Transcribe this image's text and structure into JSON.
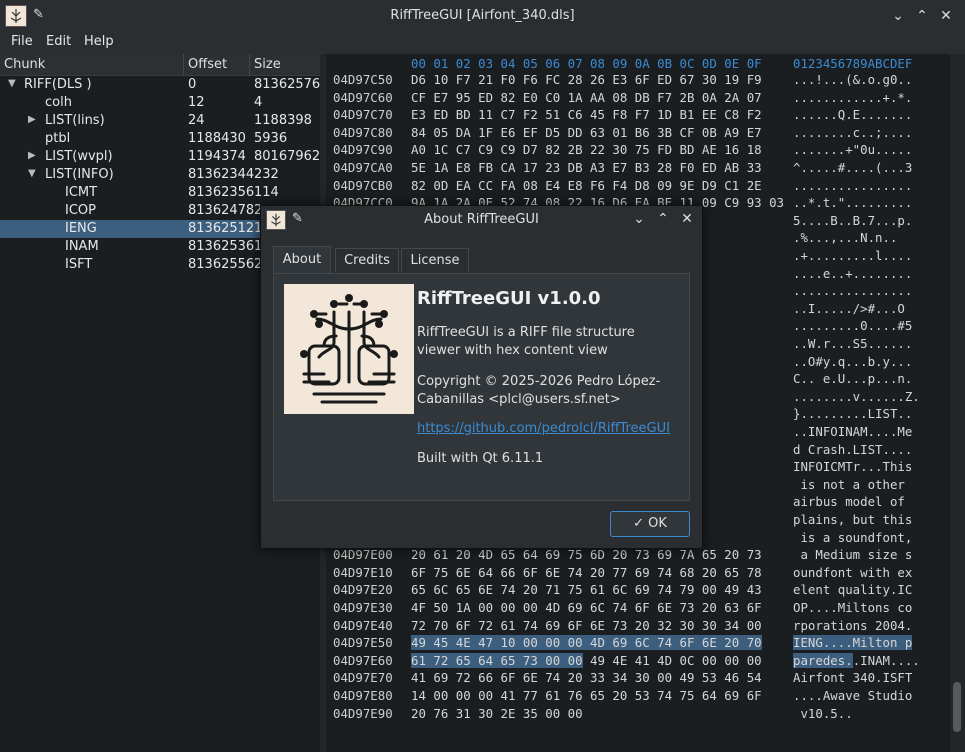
{
  "window": {
    "title": "RiffTreeGUI [Airfont_340.dls]",
    "minimize_glyph": "⌄",
    "maximize_glyph": "⌃",
    "close_glyph": "✕"
  },
  "menu": {
    "file": "File",
    "edit": "Edit",
    "help": "Help"
  },
  "tree": {
    "headers": {
      "chunk": "Chunk",
      "offset": "Offset",
      "size": "Size"
    },
    "rows": [
      {
        "label": "RIFF(DLS )",
        "offset": "0",
        "size": "81362576",
        "expanded": true,
        "depth": 0
      },
      {
        "label": "colh",
        "offset": "12",
        "size": "4",
        "depth": 1
      },
      {
        "label": "LIST(lins)",
        "offset": "24",
        "size": "1188398",
        "expandable": true,
        "depth": 1
      },
      {
        "label": "ptbl",
        "offset": "1188430",
        "size": "5936",
        "depth": 1
      },
      {
        "label": "LIST(wvpl)",
        "offset": "1194374",
        "size": "80167962",
        "expandable": true,
        "depth": 1
      },
      {
        "label": "LIST(INFO)",
        "offset": "81362344",
        "size": "232",
        "expanded": true,
        "depth": 1
      },
      {
        "label": "ICMT",
        "offset": "81362356",
        "size": "114",
        "depth": 2
      },
      {
        "label": "ICOP",
        "offset": "81362478",
        "size": "2",
        "depth": 2
      },
      {
        "label": "IENG",
        "offset": "81362512",
        "size": "1",
        "depth": 2,
        "selected": true
      },
      {
        "label": "INAM",
        "offset": "81362536",
        "size": "1",
        "depth": 2
      },
      {
        "label": "ISFT",
        "offset": "81362556",
        "size": "2",
        "depth": 2
      }
    ]
  },
  "hex": {
    "header_bytes": "00 01 02 03 04 05 06 07 08 09 0A 0B 0C 0D 0E 0F",
    "header_ascii": "0123456789ABCDEF",
    "lines": [
      {
        "off": "04D97C50",
        "bytes": "D6 10 F7 21 F0 F6 FC 28 26 E3 6F ED 67 30 19 F9",
        "ascii": "...!...(&.o.g0.."
      },
      {
        "off": "04D97C60",
        "bytes": "CF E7 95 ED 82 E0 C0 1A AA 08 DB F7 2B 0A 2A 07",
        "ascii": "............+.*."
      },
      {
        "off": "04D97C70",
        "bytes": "E3 ED BD 11 C7 F2 51 C6 45 F8 F7 1D B1 EE C8 F2",
        "ascii": "......Q.E......."
      },
      {
        "off": "04D97C80",
        "bytes": "84 05 DA 1F E6 EF D5 DD 63 01 B6 3B CF 0B A9 E7",
        "ascii": "........c..;...."
      },
      {
        "off": "04D97C90",
        "bytes": "A0 1C C7 C9 C9 D7 82 2B 22 30 75 FD BD AE 16 18",
        "ascii": ".......+\"0u....."
      },
      {
        "off": "04D97CA0",
        "bytes": "5E 1A E8 FB CA 17 23 DB A3 E7 B3 28 F0 ED AB 33",
        "ascii": "^.....#....(...3"
      },
      {
        "off": "04D97CB0",
        "bytes": "82 0D EA CC FA 08 E4 E8 F6 F4 D8 09 9E D9 C1 2E",
        "ascii": "................"
      },
      {
        "off": "04D97CC0",
        "bytes": "9A 1A 2A 0E 52 74 08 22 16 D6 EA BE 11 09 C9 93 03",
        "ascii": "..*.t.\"........."
      },
      {
        "off": "",
        "bytes": "",
        "ascii": "5....B..B.7...p."
      },
      {
        "off": "",
        "bytes": "",
        "ascii": ".%...,...N.n..  "
      },
      {
        "off": "",
        "bytes": "",
        "ascii": ".+.........l...."
      },
      {
        "off": "",
        "bytes": "",
        "ascii": "....e..+........"
      },
      {
        "off": "",
        "bytes": "",
        "ascii": "................"
      },
      {
        "off": "",
        "bytes": "",
        "ascii": "..I...../>#...O"
      },
      {
        "off": "",
        "bytes": "",
        "ascii": ".........0....#5"
      },
      {
        "off": "",
        "bytes": "",
        "ascii": "..W.r...S5......"
      },
      {
        "off": "",
        "bytes": "",
        "ascii": "..O#y.q...b.y..."
      },
      {
        "off": "",
        "bytes": "",
        "ascii": "C.. e.U...p...n."
      },
      {
        "off": "",
        "bytes": "",
        "ascii": "........v......Z."
      },
      {
        "off": "",
        "bytes": "",
        "ascii": "}.........LIST.."
      },
      {
        "off": "",
        "bytes": "",
        "ascii": "..INFOINAM....Me"
      },
      {
        "off": "",
        "bytes": "",
        "ascii": "d Crash.LIST...."
      },
      {
        "off": "",
        "bytes": "",
        "ascii": "INFOICMTr...This"
      },
      {
        "off": "",
        "bytes": "",
        "ascii": " is not a other"
      },
      {
        "off": "",
        "bytes": "",
        "ascii": "airbus model of"
      },
      {
        "off": "",
        "bytes": "",
        "ascii": "plains, but this"
      },
      {
        "off": "",
        "bytes": "",
        "ascii": " is a soundfont,"
      },
      {
        "off": "04D97E00",
        "bytes": "20 61 20 4D 65 64 69 75 6D 20 73 69 7A 65 20 73",
        "ascii": " a Medium size s"
      },
      {
        "off": "04D97E10",
        "bytes": "6F 75 6E 64 66 6F 6E 74 20 77 69 74 68 20 65 78",
        "ascii": "oundfont with ex"
      },
      {
        "off": "04D97E20",
        "bytes": "65 6C 65 6E 74 20 71 75 61 6C 69 74 79 00 49 43",
        "ascii": "elent quality.IC"
      },
      {
        "off": "04D97E30",
        "bytes": "4F 50 1A 00 00 00 4D 69 6C 74 6F 6E 73 20 63 6F",
        "ascii": "OP....Miltons co"
      },
      {
        "off": "04D97E40",
        "bytes": "72 70 6F 72 61 74 69 6F 6E 73 20 32 30 30 34 00",
        "ascii": "rporations 2004."
      },
      {
        "off": "04D97E50",
        "bytes": "49 45 4E 47 10 00 00 00 4D 69 6C 74 6F 6E 20 70",
        "ascii": "IENG....Milton p",
        "hl": "full"
      },
      {
        "off": "04D97E60",
        "bytes_hl": "61 72 65 64 65 73 00 00",
        "bytes_rest": " 49 4E 41 4D 0C 00 00 00",
        "ascii_hl": "paredes.",
        "ascii_rest": ".INAM....",
        "hl": "partial"
      },
      {
        "off": "04D97E70",
        "bytes": "41 69 72 66 6F 6E 74 20 33 34 30 00 49 53 46 54",
        "ascii": "Airfont 340.ISFT"
      },
      {
        "off": "04D97E80",
        "bytes": "14 00 00 00 41 77 61 76 65 20 53 74 75 64 69 6F",
        "ascii": "....Awave Studio"
      },
      {
        "off": "04D97E90",
        "bytes": "20 76 31 30 2E 35 00 00",
        "ascii": " v10.5.."
      }
    ]
  },
  "dialog": {
    "title": "About RiffTreeGUI",
    "tabs": [
      "About",
      "Credits",
      "License"
    ],
    "app_name": "RiffTreeGUI v1.0.0",
    "description": "RiffTreeGUI is a RIFF file structure viewer with hex content view",
    "copyright": "Copyright © 2025-2026 Pedro López-Cabanillas <plcl@users.sf.net>",
    "url": "https://github.com/pedrolcl/RiffTreeGUI",
    "built_with": "Built with Qt 6.11.1",
    "ok_label": "OK",
    "ok_icon": "check-icon"
  },
  "colors": {
    "accent": "#3b8bd3",
    "selection": "#3d5f7f",
    "background": "#1b1e20"
  }
}
